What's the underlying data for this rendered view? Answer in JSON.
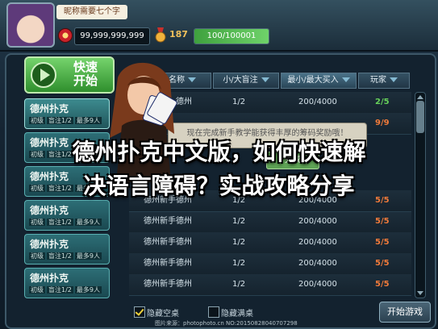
{
  "header": {
    "nickname": "昵称需要七个字",
    "chips": "99,999,999,999",
    "level": "187",
    "exp_text": "100/100001",
    "exp_fraction": 1.0
  },
  "quick_start": {
    "label": "快速开始",
    "line1": "快速",
    "line2": "开始"
  },
  "rooms": [
    {
      "title": "德州扑克",
      "tag1": "初级",
      "tag2": "盲注1/2",
      "tag3": "最多9人"
    },
    {
      "title": "德州扑克",
      "tag1": "初级",
      "tag2": "盲注1/2",
      "tag3": "最多9人"
    },
    {
      "title": "德州扑克",
      "tag1": "初级",
      "tag2": "盲注1/2",
      "tag3": "最多9人"
    },
    {
      "title": "德州扑克",
      "tag1": "初级",
      "tag2": "盲注1/2",
      "tag3": "最多9人"
    },
    {
      "title": "德州扑克",
      "tag1": "初级",
      "tag2": "盲注1/2",
      "tag3": "最多9人"
    },
    {
      "title": "德州扑克",
      "tag1": "初级",
      "tag2": "盲注1/2",
      "tag3": "最多9人"
    }
  ],
  "table_header": {
    "name": "名称",
    "blinds": "小/大盲注",
    "buyin": "最小/最大买入",
    "players": "玩家"
  },
  "table_rows": [
    {
      "name": "德州",
      "blinds": "1/2",
      "buyin": "200/4000",
      "players": "2/5"
    },
    {
      "name": "",
      "blinds": "",
      "buyin": "",
      "players": "9/9"
    },
    {
      "name": "德州新手德州",
      "blinds": "1/2",
      "buyin": "200/4000",
      "players": "5/5"
    },
    {
      "name": "德州新手德州",
      "blinds": "1/2",
      "buyin": "200/4000",
      "players": "5/5"
    },
    {
      "name": "德州新手德州",
      "blinds": "1/2",
      "buyin": "200/4000",
      "players": "5/5"
    },
    {
      "name": "德州新手德州",
      "blinds": "1/2",
      "buyin": "200/4000",
      "players": "5/5"
    },
    {
      "name": "德州新手德州",
      "blinds": "1/2",
      "buyin": "200/4000",
      "players": "5/5"
    }
  ],
  "popup": {
    "text": "现在完成新手教学能获得丰厚的筹码奖励哦！",
    "button": "完成"
  },
  "footer": {
    "hide_empty": "隐藏空桌",
    "hide_full": "隐藏满桌",
    "start": "开始游戏"
  },
  "caption": {
    "line1": "德州扑克中文版，如何快速解",
    "line2": "决语言障碍？实战攻略分享"
  },
  "watermark": "图片来源：photophoto.cn  NO:20150828040707298"
}
